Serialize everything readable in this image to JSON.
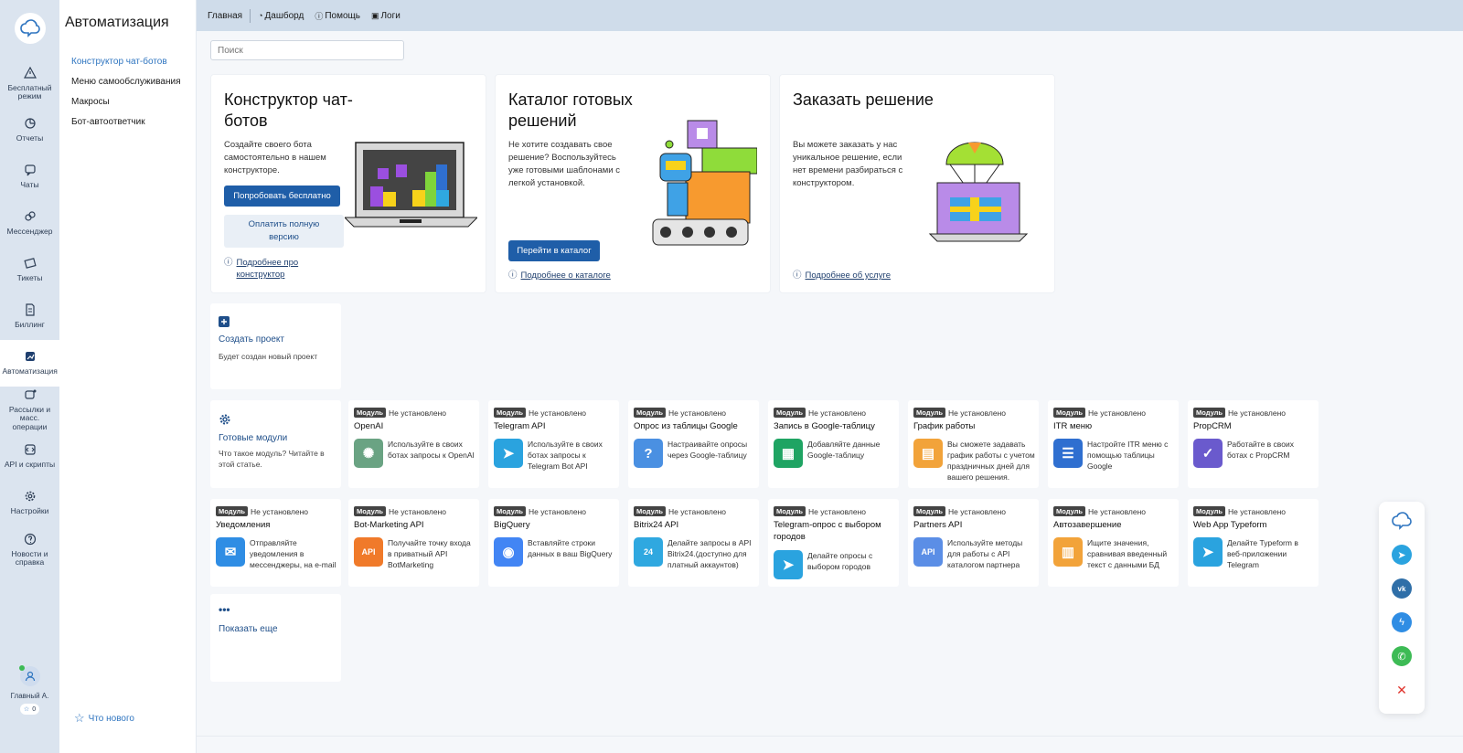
{
  "rail": {
    "items": [
      {
        "label": "Бесплатный режим",
        "icon": "warning-icon"
      },
      {
        "label": "Отчеты",
        "icon": "pie-chart-icon"
      },
      {
        "label": "Чаты",
        "icon": "chat-icon"
      },
      {
        "label": "Мессенджер",
        "icon": "messenger-icon"
      },
      {
        "label": "Тикеты",
        "icon": "ticket-icon"
      },
      {
        "label": "Биллинг",
        "icon": "document-icon"
      },
      {
        "label": "Автоматизация",
        "icon": "automation-icon"
      },
      {
        "label": "Рассылки и масс. операции",
        "icon": "broadcast-icon"
      },
      {
        "label": "API и скрипты",
        "icon": "code-icon"
      },
      {
        "label": "Настройки",
        "icon": "gear-icon"
      },
      {
        "label": "Новости и справка",
        "icon": "help-icon"
      }
    ],
    "user": {
      "name": "Главный А.",
      "stars": "0"
    }
  },
  "panel": {
    "title": "Автоматизация",
    "menu": [
      "Конструктор чат-ботов",
      "Меню самообслуживания",
      "Макросы",
      "Бот-автоответчик"
    ],
    "whats_new": "Что нового"
  },
  "topbar": {
    "home": "Главная",
    "dashboard": "Дашборд",
    "help": "Помощь",
    "logs": "Логи"
  },
  "search": {
    "placeholder": "Поиск"
  },
  "promos": [
    {
      "title": "Конструктор чат-ботов",
      "text": "Создайте своего бота самостоятельно в нашем конструкторе.",
      "primary": "Попробовать бесплатно",
      "secondary": "Оплатить полную версию",
      "link": "Подробнее про конструктор"
    },
    {
      "title": "Каталог готовых решений",
      "text": "Не хотите создавать свое решение? Воспользуйтесь уже готовыми шаблонами с легкой установкой.",
      "primary": "Перейти в каталог",
      "link": "Подробнее о каталоге"
    },
    {
      "title": "Заказать решение",
      "text": "Вы можете заказать у нас уникальное решение, если нет времени разбираться с конструктором.",
      "link": "Подробнее об услуге"
    }
  ],
  "create": {
    "title": "Создать проект",
    "desc": "Будет создан новый проект"
  },
  "ready": {
    "title": "Готовые модули",
    "desc": "Что такое модуль? Читайте в этой статье."
  },
  "show_more": "Показать еще",
  "module_tag": "Модуль",
  "module_status": "Не установлено",
  "modules": [
    {
      "name": "OpenAI",
      "desc": "Используйте в своих ботах запросы к OpenAI",
      "color": "#6aa383",
      "glyph": "✺"
    },
    {
      "name": "Telegram API",
      "desc": "Используйте в своих ботах запросы к Telegram Bot API",
      "color": "#2aa3df",
      "glyph": "➤"
    },
    {
      "name": "Опрос из таблицы Google",
      "desc": "Настраивайте опросы через Google-таблицу",
      "color": "#4a90e2",
      "glyph": "?"
    },
    {
      "name": "Запись в Google-таблицу",
      "desc": "Добавляйте данные Google-таблицу",
      "color": "#1fa463",
      "glyph": "▦"
    },
    {
      "name": "График работы",
      "desc": "Вы сможете задавать график работы с учетом праздничных дней для вашего решения.",
      "color": "#f2a33a",
      "glyph": "▤"
    },
    {
      "name": "ITR меню",
      "desc": "Настройте ITR меню с помощью таблицы Google",
      "color": "#2f6fd0",
      "glyph": "☰"
    },
    {
      "name": "PropCRM",
      "desc": "Работайте в своих ботах с PropCRM",
      "color": "#6a5acd",
      "glyph": "✓"
    },
    {
      "name": "Уведомления",
      "desc": "Отправляйте уведомления в мессенджеры, на e-mail",
      "color": "#2f8de4",
      "glyph": "✉"
    },
    {
      "name": "Bot-Marketing API",
      "desc": "Получайте точку входа в приватный API BotMarketing",
      "color": "#f07a2a",
      "glyph": "API"
    },
    {
      "name": "BigQuery",
      "desc": "Вставляйте строки данных в ваш BigQuery",
      "color": "#4285f4",
      "glyph": "◉"
    },
    {
      "name": "Bitrix24 API",
      "desc": "Делайте запросы в API Bitrix24.(доступно для платный аккаунтов)",
      "color": "#2fa8e0",
      "glyph": "24"
    },
    {
      "name": "Telegram-опрос с выбором городов",
      "desc": "Делайте опросы с выбором городов",
      "color": "#2aa3df",
      "glyph": "➤"
    },
    {
      "name": "Partners API",
      "desc": "Используйте методы для работы с API каталогом партнера",
      "color": "#5b8ee6",
      "glyph": "API"
    },
    {
      "name": "Автозавершение",
      "desc": "Ищите значения, сравнивая введенный текст с данными БД",
      "color": "#f2a33a",
      "glyph": "▥"
    },
    {
      "name": "Web App Typeform",
      "desc": "Делайте Typeform в веб-приложении Telegram",
      "color": "#2aa3df",
      "glyph": "➤"
    }
  ],
  "colors": {
    "primary": "#1f5ea8",
    "link": "#2f75c0",
    "rail": "#dbe4ef",
    "topbar": "#cfdcea"
  }
}
